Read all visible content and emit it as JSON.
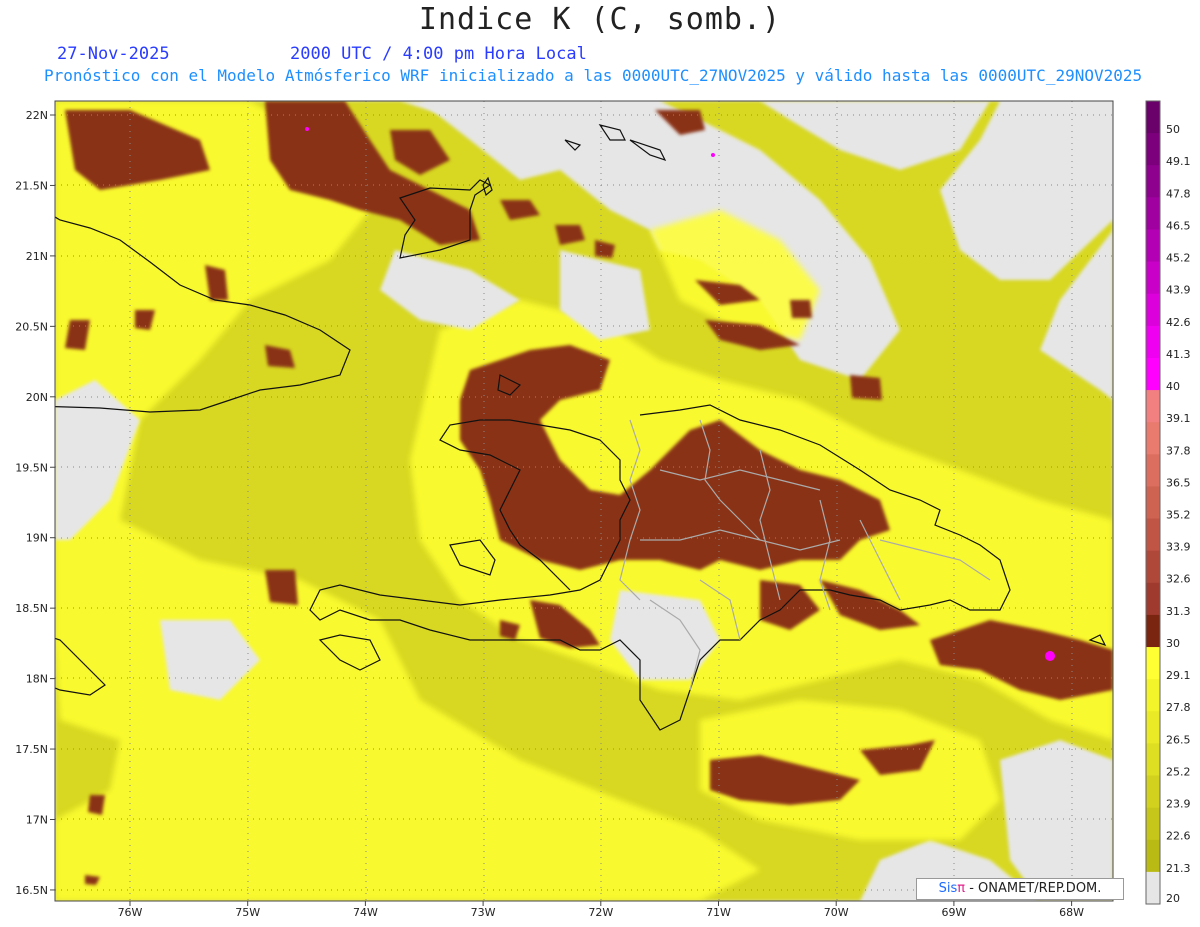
{
  "header": {
    "title": "Indice K (C, somb.)",
    "date": "27-Nov-2025",
    "time": "2000 UTC / 4:00 pm Hora Local",
    "subtitle": "Pronóstico con el Modelo Atmósferico WRF inicializado a las 0000UTC_27NOV2025 y válido hasta las  0000UTC_29NOV2025"
  },
  "axes": {
    "lat_labels": [
      "22N",
      "21.5N",
      "21N",
      "20.5N",
      "20N",
      "19.5N",
      "19N",
      "18.5N",
      "18N",
      "17.5N",
      "17N",
      "16.5N"
    ],
    "lat_values": [
      22,
      21.5,
      21,
      20.5,
      20,
      19.5,
      19,
      18.5,
      18,
      17.5,
      17,
      16.5
    ],
    "lon_labels": [
      "76W",
      "75W",
      "74W",
      "73W",
      "72W",
      "71W",
      "70W",
      "69W",
      "68W"
    ],
    "lon_values": [
      -76,
      -75,
      -74,
      -73,
      -72,
      -71,
      -70,
      -69,
      -68
    ]
  },
  "colorbar": {
    "labels": [
      "50",
      "49.1",
      "47.8",
      "46.5",
      "45.2",
      "43.9",
      "42.6",
      "41.3",
      "40",
      "39.1",
      "37.8",
      "36.5",
      "35.2",
      "33.9",
      "32.6",
      "31.3",
      "30",
      "29.1",
      "27.8",
      "26.5",
      "25.2",
      "23.9",
      "22.6",
      "21.3",
      "20"
    ],
    "colors": [
      "#6a006a",
      "#7c007c",
      "#8e008e",
      "#a000a0",
      "#b400b4",
      "#c800c8",
      "#dc00dc",
      "#f000f0",
      "#ff00ff",
      "#f28080",
      "#e87a6e",
      "#dc6e60",
      "#cf6352",
      "#c05546",
      "#b0483a",
      "#9e3a2e",
      "#7a2510",
      "#ffff33",
      "#f4f42a",
      "#eaea26",
      "#dede22",
      "#d2d21e",
      "#c6c61a",
      "#baba14",
      "#e6e6e6"
    ]
  },
  "credit": {
    "sis": "Sis",
    "pi": "π",
    "rest": "- ONAMET/REP.DOM."
  }
}
